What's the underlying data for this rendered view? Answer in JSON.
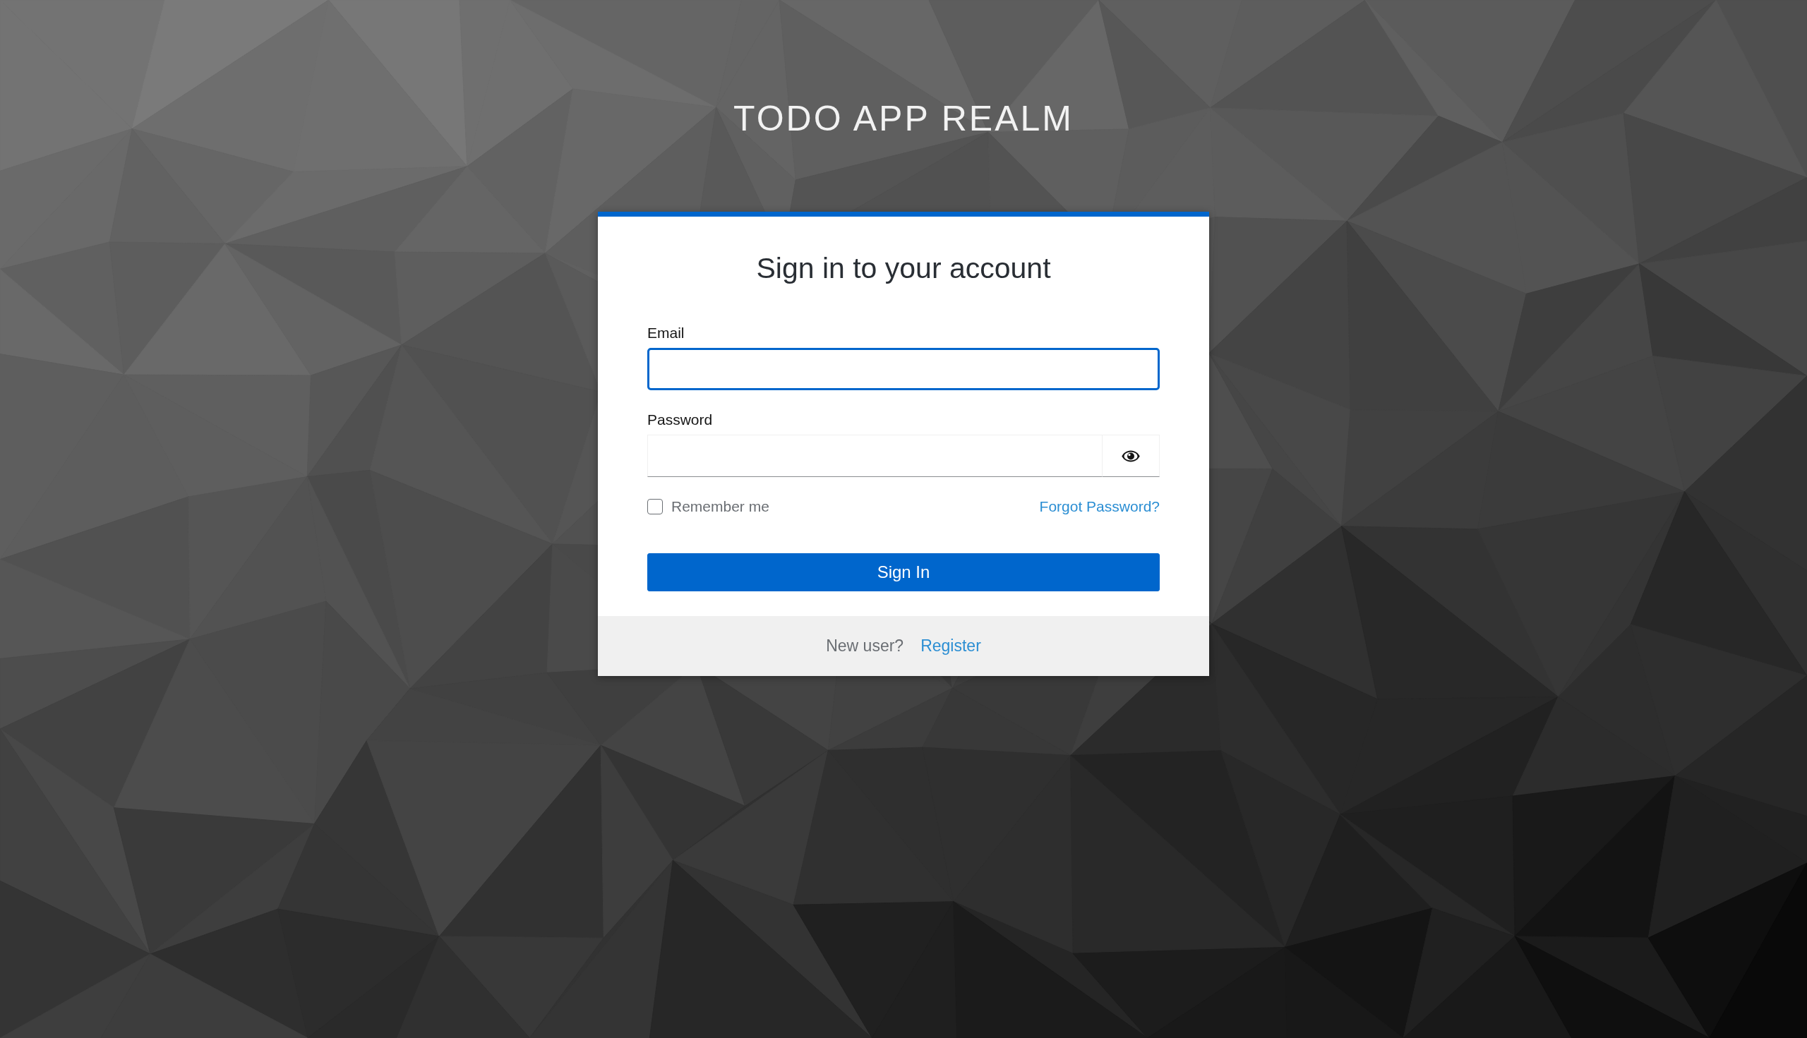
{
  "realm_title": "TODO APP REALM",
  "card": {
    "title": "Sign in to your account",
    "fields": [
      {
        "label": "Email",
        "kind": "text",
        "focused": true
      },
      {
        "label": "Password",
        "kind": "password",
        "focused": false
      }
    ],
    "remember_me": {
      "label": "Remember me",
      "checked": false
    },
    "forgot_password": "Forgot Password?",
    "submit_button": "Sign In",
    "footer": {
      "text": "New user?",
      "link": "Register"
    }
  }
}
